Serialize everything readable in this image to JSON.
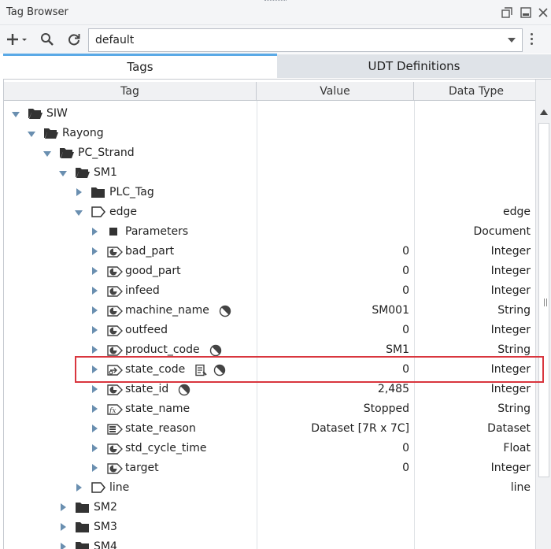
{
  "window": {
    "title": "Tag Browser"
  },
  "toolbar": {
    "provider_value": "default"
  },
  "tabs": [
    {
      "label": "Tags",
      "active": true
    },
    {
      "label": "UDT Definitions",
      "active": false
    }
  ],
  "columns": {
    "tag": "Tag",
    "value": "Value",
    "datatype": "Data Type"
  },
  "tree": [
    {
      "name": "SIW",
      "icon": "folder-open-icon",
      "expand": "down",
      "value": "",
      "datatype": ""
    },
    {
      "name": "Rayong",
      "icon": "folder-open-icon",
      "expand": "down",
      "value": "",
      "datatype": ""
    },
    {
      "name": "PC_Strand",
      "icon": "folder-open-icon",
      "expand": "down",
      "value": "",
      "datatype": ""
    },
    {
      "name": "SM1",
      "icon": "folder-open-icon",
      "expand": "down",
      "value": "",
      "datatype": ""
    },
    {
      "name": "PLC_Tag",
      "icon": "folder-icon",
      "expand": "right",
      "value": "",
      "datatype": ""
    },
    {
      "name": "edge",
      "icon": "udt-instance-icon",
      "expand": "down",
      "value": "",
      "datatype": "edge"
    },
    {
      "name": "Parameters",
      "icon": "parameters-icon",
      "expand": "right",
      "value": "",
      "datatype": "Document"
    },
    {
      "name": "bad_part",
      "icon": "opc-tag-icon",
      "expand": "right",
      "value": "0",
      "datatype": "Integer"
    },
    {
      "name": "good_part",
      "icon": "opc-tag-icon",
      "expand": "right",
      "value": "0",
      "datatype": "Integer"
    },
    {
      "name": "infeed",
      "icon": "opc-tag-icon",
      "expand": "right",
      "value": "0",
      "datatype": "Integer"
    },
    {
      "name": "machine_name",
      "icon": "opc-tag-icon",
      "expand": "right",
      "value": "SM001",
      "datatype": "String",
      "badges": [
        "history-icon"
      ]
    },
    {
      "name": "outfeed",
      "icon": "opc-tag-icon",
      "expand": "right",
      "value": "0",
      "datatype": "Integer"
    },
    {
      "name": "product_code",
      "icon": "opc-tag-icon",
      "expand": "right",
      "value": "SM1",
      "datatype": "String",
      "badges": [
        "history-icon"
      ]
    },
    {
      "name": "state_code",
      "icon": "reference-tag-icon",
      "expand": "right",
      "value": "0",
      "datatype": "Integer",
      "badges": [
        "documentation-icon",
        "history-icon"
      ]
    },
    {
      "name": "state_id",
      "icon": "opc-tag-icon",
      "expand": "right",
      "value": "2,485",
      "datatype": "Integer",
      "badges": [
        "history-icon"
      ]
    },
    {
      "name": "state_name",
      "icon": "expression-tag-icon",
      "expand": "right",
      "value": "Stopped",
      "datatype": "String"
    },
    {
      "name": "state_reason",
      "icon": "dataset-tag-icon",
      "expand": "right",
      "value": "Dataset [7R x 7C]",
      "datatype": "Dataset"
    },
    {
      "name": "std_cycle_time",
      "icon": "opc-tag-icon",
      "expand": "right",
      "value": "0",
      "datatype": "Float"
    },
    {
      "name": "target",
      "icon": "opc-tag-icon",
      "expand": "right",
      "value": "0",
      "datatype": "Integer"
    },
    {
      "name": "line",
      "icon": "udt-instance-icon",
      "expand": "right",
      "value": "",
      "datatype": "line"
    },
    {
      "name": "SM2",
      "icon": "folder-icon",
      "expand": "right",
      "value": "",
      "datatype": ""
    },
    {
      "name": "SM3",
      "icon": "folder-icon",
      "expand": "right",
      "value": "",
      "datatype": ""
    },
    {
      "name": "SM4",
      "icon": "folder-icon",
      "expand": "right",
      "value": "",
      "datatype": ""
    }
  ],
  "colors": {
    "accent": "#5aa9e6",
    "highlight": "#d9363e",
    "arrow": "#6a8fb0"
  }
}
